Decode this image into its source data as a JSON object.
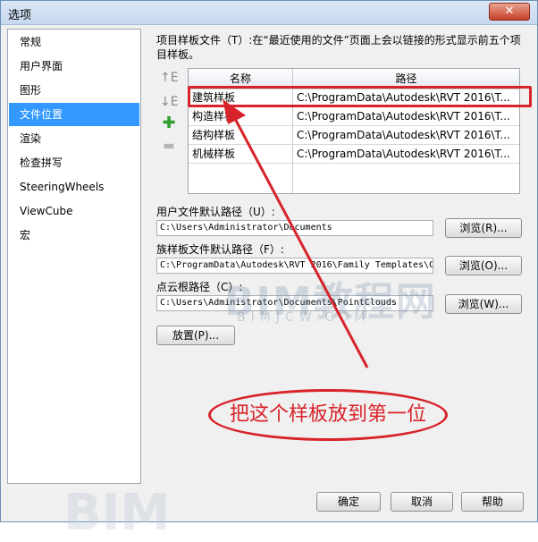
{
  "window": {
    "title": "选项",
    "close_glyph": "✕"
  },
  "sidebar": {
    "items": [
      {
        "label": "常规"
      },
      {
        "label": "用户界面"
      },
      {
        "label": "图形"
      },
      {
        "label": "文件位置",
        "selected": true
      },
      {
        "label": "渲染"
      },
      {
        "label": "检查拼写"
      },
      {
        "label": "SteeringWheels"
      },
      {
        "label": "ViewCube"
      },
      {
        "label": "宏"
      }
    ]
  },
  "templates": {
    "description": "项目样板文件（T）:在“最近使用的文件”页面上会以链接的形式显示前五个项目样板。",
    "move_up_glyph": "↑E",
    "move_down_glyph": "↓E",
    "add_glyph": "✚",
    "remove_glyph": "▬",
    "columns": [
      "名称",
      "路径"
    ],
    "rows": [
      {
        "name": "建筑样板",
        "path": "C:\\ProgramData\\Autodesk\\RVT 2016\\T..."
      },
      {
        "name": "构造样板",
        "path": "C:\\ProgramData\\Autodesk\\RVT 2016\\T..."
      },
      {
        "name": "结构样板",
        "path": "C:\\ProgramData\\Autodesk\\RVT 2016\\T..."
      },
      {
        "name": "机械样板",
        "path": "C:\\ProgramData\\Autodesk\\RVT 2016\\T..."
      }
    ]
  },
  "paths": {
    "user_files_label": "用户文件默认路径（U）:",
    "user_files_value": "C:\\Users\\Administrator\\Documents",
    "user_files_browse": "浏览(R)...",
    "family_label": "族样板文件默认路径（F）:",
    "family_value": "C:\\ProgramData\\Autodesk\\RVT 2016\\Family Templates\\C",
    "family_browse": "浏览(O)...",
    "pointcloud_label": "点云根路径（C）:",
    "pointcloud_value": "C:\\Users\\Administrator\\Documents\\PointClouds",
    "pointcloud_browse": "浏览(W)...",
    "places_button": "放置(P)..."
  },
  "annotation": {
    "callout_text": "把这个样板放到第一位",
    "color": "#d8232a"
  },
  "watermark": {
    "main": "BIM教程网",
    "sub": "BIMJCW.COM",
    "bottom": "BIM"
  },
  "footer": {
    "ok": "确定",
    "cancel": "取消",
    "help": "帮助"
  }
}
